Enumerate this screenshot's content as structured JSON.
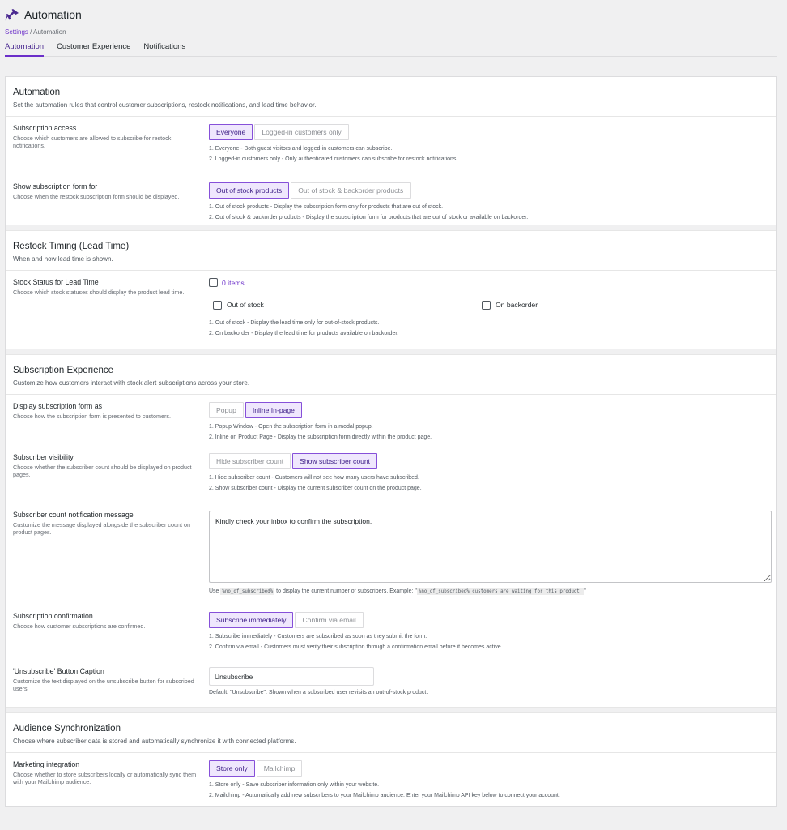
{
  "header": {
    "title": "Automation",
    "breadcrumb": {
      "settings": "Settings",
      "separator": " / ",
      "current": "Automation"
    },
    "tabs": [
      {
        "label": "Automation",
        "active": true
      },
      {
        "label": "Customer Experience",
        "active": false
      },
      {
        "label": "Notifications",
        "active": false
      }
    ]
  },
  "colors": {
    "accent": "#6b2fc9",
    "accent_bg": "#efe7fd",
    "page_bg": "#f0f0f1"
  },
  "sections": {
    "automation": {
      "title": "Automation",
      "desc": "Set the automation rules that control customer subscriptions, restock notifications, and lead time behavior.",
      "subscription_access": {
        "label": "Subscription access",
        "desc": "Choose which customers are allowed to subscribe for restock notifications.",
        "options": [
          "Everyone",
          "Logged-in customers only"
        ],
        "selected": "Everyone",
        "notes": [
          "1. Everyone - Both guest visitors and logged-in customers can subscribe.",
          "2. Logged-in customers only - Only authenticated customers can subscribe for restock notifications."
        ]
      },
      "show_form_for": {
        "label": "Show subscription form for",
        "desc": "Choose when the restock subscription form should be displayed.",
        "options": [
          "Out of stock products",
          "Out of stock & backorder products"
        ],
        "selected": "Out of stock products",
        "notes": [
          "1. Out of stock products - Display the subscription form only for products that are out of stock.",
          "2. Out of stock & backorder products - Display the subscription form for products that are out of stock or available on backorder."
        ]
      }
    },
    "restock_timing": {
      "title": "Restock Timing (Lead Time)",
      "desc": "When and how lead time is shown.",
      "stock_status": {
        "label": "Stock Status for Lead Time",
        "desc": "Choose which stock statuses should display the product lead time.",
        "select_all": "0 items",
        "options": [
          "Out of stock",
          "On backorder"
        ],
        "notes": [
          "1. Out of stock - Display the lead time only for out-of-stock products.",
          "2. On backorder - Display the lead time for products available on backorder."
        ]
      }
    },
    "subscription_experience": {
      "title": "Subscription Experience",
      "desc": "Customize how customers interact with stock alert subscriptions across your store.",
      "display_form_as": {
        "label": "Display subscription form as",
        "desc": "Choose how the subscription form is presented to customers.",
        "options": [
          "Popup",
          "Inline In-page"
        ],
        "selected": "Inline In-page",
        "notes": [
          "1. Popup Window - Open the subscription form in a modal popup.",
          "2. Inline on Product Page - Display the subscription form directly within the product page."
        ]
      },
      "subscriber_visibility": {
        "label": "Subscriber visibility",
        "desc": "Choose whether the subscriber count should be displayed on product pages.",
        "options": [
          "Hide subscriber count",
          "Show subscriber count"
        ],
        "selected": "Show subscriber count",
        "notes": [
          "1. Hide subscriber count - Customers will not see how many users have subscribed.",
          "2. Show subscriber count - Display the current subscriber count on the product page."
        ]
      },
      "count_message": {
        "label": "Subscriber count notification message",
        "desc": "Customize the message displayed alongside the subscriber count on product pages.",
        "value": "Kindly check your inbox to confirm the subscription.",
        "hint_pre": "Use ",
        "hint_code1": "%no_of_subscribed%",
        "hint_mid": " to display the current number of subscribers. Example: \"",
        "hint_code2": "%no_of_subscribed% customers are waiting for this product.",
        "hint_post": "\""
      },
      "confirmation": {
        "label": "Subscription confirmation",
        "desc": "Choose how customer subscriptions are confirmed.",
        "options": [
          "Subscribe immediately",
          "Confirm via email"
        ],
        "selected": "Subscribe immediately",
        "notes": [
          "1. Subscribe immediately - Customers are subscribed as soon as they submit the form.",
          "2. Confirm via email - Customers must verify their subscription through a confirmation email before it becomes active."
        ]
      },
      "unsubscribe": {
        "label": "'Unsubscribe' Button Caption",
        "desc": "Customize the text displayed on the unsubscribe button for subscribed users.",
        "value": "Unsubscribe",
        "hint": "Default: \"Unsubscribe\". Shown when a subscribed user revisits an out-of-stock product."
      }
    },
    "audience": {
      "title": "Audience Synchronization",
      "desc": "Choose where subscriber data is stored and automatically synchronize it with connected platforms.",
      "marketing": {
        "label": "Marketing integration",
        "desc": "Choose whether to store subscribers locally or automatically sync them with your Mailchimp audience.",
        "options": [
          "Store only",
          "Mailchimp"
        ],
        "selected": "Store only",
        "notes": [
          "1. Store only - Save subscriber information only within your website.",
          "2. Mailchimp - Automatically add new subscribers to your Mailchimp audience. Enter your Mailchimp API key below to connect your account."
        ]
      }
    }
  }
}
